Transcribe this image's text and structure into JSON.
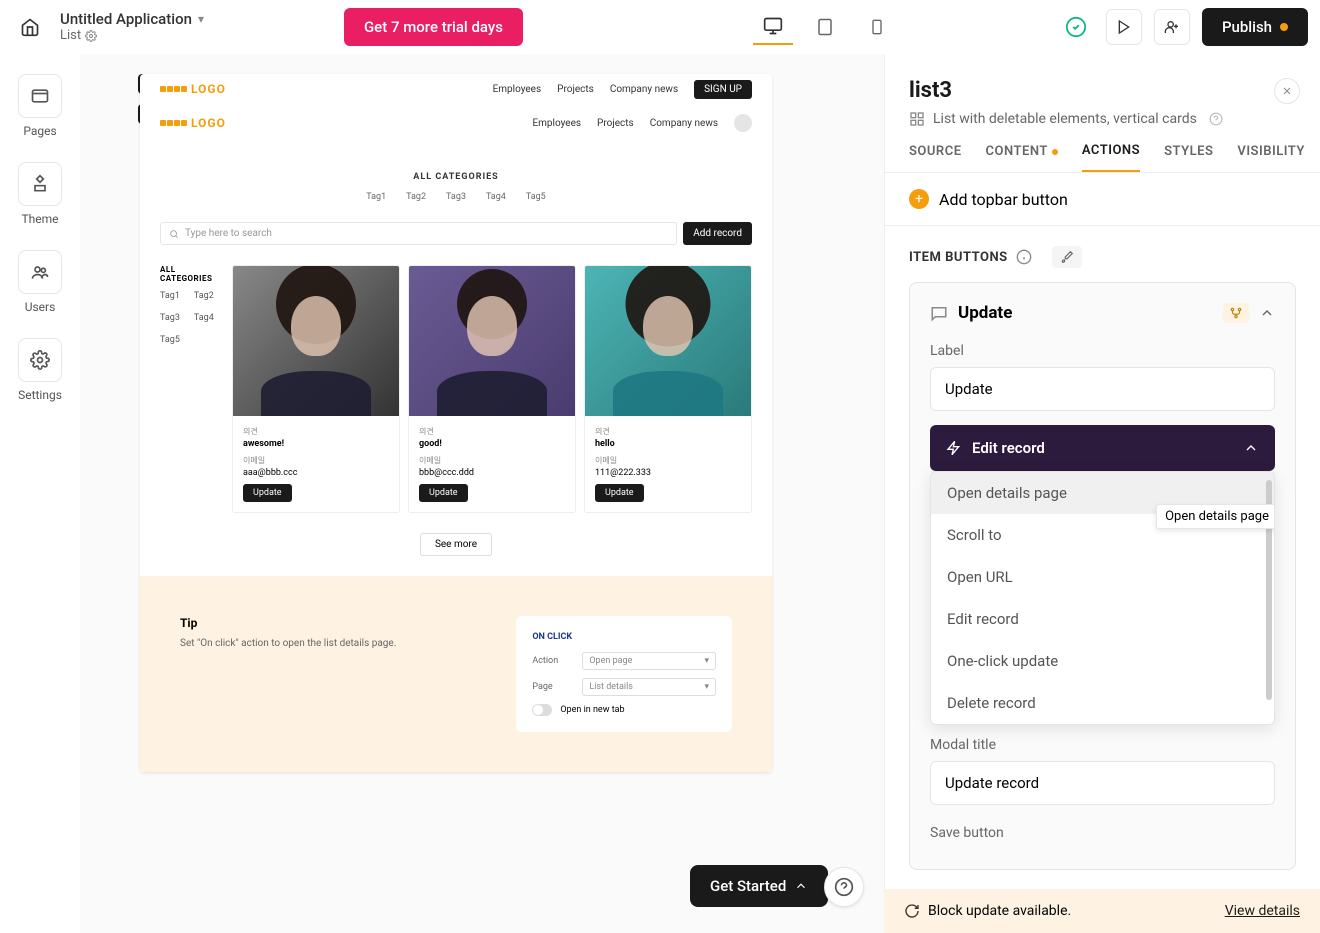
{
  "topbar": {
    "app_title": "Untitled Application",
    "breadcrumb": "List",
    "trial_button": "Get 7 more trial days",
    "publish": "Publish"
  },
  "left_rail": {
    "pages": "Pages",
    "theme": "Theme",
    "users": "Users",
    "settings": "Settings"
  },
  "preview": {
    "logo": "LOGO",
    "nav": {
      "employees": "Employees",
      "projects": "Projects",
      "company_news": "Company news",
      "signup": "SIGN UP"
    },
    "all_categories": "ALL CATEGORIES",
    "tags": [
      "Tag1",
      "Tag2",
      "Tag3",
      "Tag4",
      "Tag5"
    ],
    "search_placeholder": "Type here to search",
    "add_record": "Add record",
    "side_all_categories": "ALL CATEGORIES",
    "cards": [
      {
        "label1": "의견",
        "value1": "awesome!",
        "label2": "이메일",
        "value2": "aaa@bbb.ccc",
        "btn": "Update"
      },
      {
        "label1": "의견",
        "value1": "good!",
        "label2": "이메일",
        "value2": "bbb@ccc.ddd",
        "btn": "Update"
      },
      {
        "label1": "의견",
        "value1": "hello",
        "label2": "이메일",
        "value2": "111@222.333",
        "btn": "Update"
      }
    ],
    "see_more": "See more"
  },
  "tip": {
    "title": "Tip",
    "text": "Set \"On click\" action to open the list details page.",
    "panel_title": "ON CLICK",
    "action_label": "Action",
    "action_value": "Open page",
    "page_label": "Page",
    "page_value": "List details",
    "new_tab": "Open in new tab"
  },
  "right_panel": {
    "title": "list3",
    "subtitle": "List with deletable elements, vertical cards",
    "tabs": {
      "source": "SOURCE",
      "content": "CONTENT",
      "actions": "ACTIONS",
      "styles": "STYLES",
      "visibility": "VISIBILITY"
    },
    "add_topbar_button": "Add topbar button",
    "item_buttons": "ITEM BUTTONS",
    "action": {
      "name": "Update",
      "label_field": "Label",
      "label_value": "Update",
      "edit_record": "Edit record",
      "modal_title_label": "Modal title",
      "modal_title_value": "Update record",
      "save_button_label": "Save button"
    },
    "dropdown": {
      "open_details": "Open details page",
      "scroll_to": "Scroll to",
      "open_url": "Open URL",
      "edit_record": "Edit record",
      "one_click": "One-click update",
      "delete_record": "Delete record",
      "tooltip": "Open details page"
    }
  },
  "get_started": "Get Started",
  "banner": {
    "message": "Block update available.",
    "link": "View details"
  }
}
